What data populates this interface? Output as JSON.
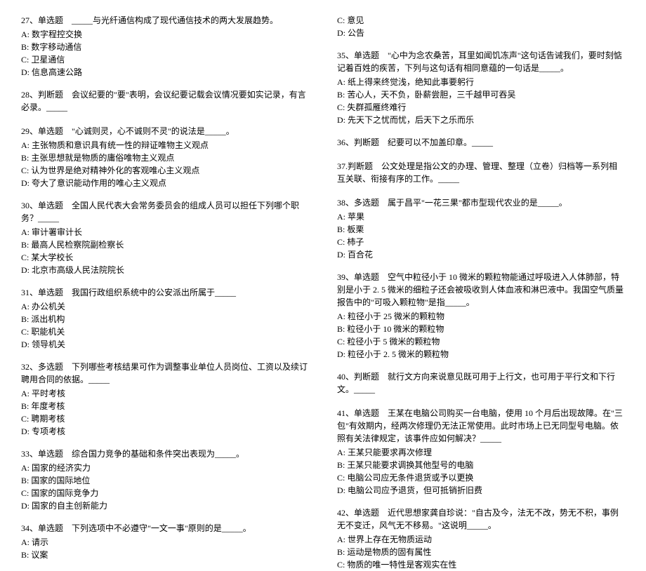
{
  "leftColumn": {
    "q27": {
      "text": "27、单选题　_____与光纤通信构成了现代通信技术的两大发展趋势。",
      "options": [
        "A: 数字程控交换",
        "B: 数字移动通信",
        "C: 卫星通信",
        "D: 信息高速公路"
      ]
    },
    "q28": {
      "text": "28、判断题　会议纪要的\"要\"表明，会议纪要记载会议情况要如实记录，有言必录。_____"
    },
    "q29": {
      "text": "29、单选题　\"心诚则灵，心不诚则不灵\"的说法是_____。",
      "options": [
        "A: 主张物质和意识具有统一性的辩证唯物主义观点",
        "B: 主张思想就是物质的庸俗唯物主义观点",
        "C: 认为世界是绝对精神外化的客观唯心主义观点",
        "D: 夸大了意识能动作用的唯心主义观点"
      ]
    },
    "q30": {
      "text": "30、单选题　全国人民代表大会常务委员会的组成人员可以担任下列哪个职务？_____",
      "options": [
        "A: 审计署审计长",
        "B: 最高人民检察院副检察长",
        "C: 某大学校长",
        "D: 北京市高级人民法院院长"
      ]
    },
    "q31": {
      "text": "31、单选题　我国行政组织系统中的公安派出所属于_____",
      "options": [
        "A: 办公机关",
        "B: 派出机构",
        "C: 职能机关",
        "D: 领导机关"
      ]
    },
    "q32": {
      "text": "32、多选题　下列哪些考核结果可作为调整事业单位人员岗位、工资以及续订聘用合同的依据。_____",
      "options": [
        "A: 平时考核",
        "B: 年度考核",
        "C: 聘期考核",
        "D: 专项考核"
      ]
    },
    "q33": {
      "text": "33、单选题　综合国力竞争的基础和条件突出表现为_____。",
      "options": [
        "A: 国家的经济实力",
        "B: 国家的国际地位",
        "C: 国家的国际竞争力",
        "D: 国家的自主创新能力"
      ]
    },
    "q34": {
      "text": "34、单选题　下列选项中不必遵守\"一文一事\"原则的是_____。",
      "options": [
        "A: 请示",
        "B: 议案"
      ]
    }
  },
  "rightColumn": {
    "q34cont": {
      "options": [
        "C: 意见",
        "D: 公告"
      ]
    },
    "q35": {
      "text": "35、单选题　\"心中为念农桑苦，耳里如闻饥冻声\"这句话告诫我们，要时刻惦记着百姓的疾苦，下列与这句话有相同意蕴的一句话是_____。",
      "options": [
        "A: 纸上得来终觉浅，绝知此事要躬行",
        "B: 苦心人，天不负，卧薪尝胆，三千越甲可吞吴",
        "C: 失群孤雁终难行",
        "D: 先天下之忧而忧，后天下之乐而乐"
      ]
    },
    "q36": {
      "text": "36、判断题　纪要可以不加盖印章。_____"
    },
    "q37": {
      "text": "37.判断题　公文处理是指公文的办理、管理、整理（立卷）归档等一系列相互关联、衔接有序的工作。_____"
    },
    "q38": {
      "text": "38、多选题　属于昌平\"一花三果\"都市型现代农业的是_____。",
      "options": [
        "A: 苹果",
        "B: 板栗",
        "C: 柿子",
        "D: 百合花"
      ]
    },
    "q39": {
      "text": "39、单选题　空气中粒径小于 10 微米的颗粒物能通过呼吸进入人体肺部，特别是小于 2. 5 微米的细粒子还会被吸收到人体血液和淋巴液中。我国空气质量报告中的\"可吸入颗粒物\"是指_____。",
      "options": [
        "A: 粒径小于 25 微米的颗粒物",
        "B: 粒径小于 10 微米的颗粒物",
        "C: 粒径小于 5 微米的颗粒物",
        "D: 粒径小于 2. 5 微米的颗粒物"
      ]
    },
    "q40": {
      "text": "40、判断题　就行文方向来说意见既可用于上行文，也可用于平行文和下行文。_____"
    },
    "q41": {
      "text": "41、单选题　王某在电脑公司购买一台电脑，使用 10 个月后出现故障。在\"三包\"有效期内，经两次修理仍无法正常使用。此时市场上已无同型号电脑。依照有关法律规定，该事件应如何解决？_____",
      "options": [
        "A: 王某只能要求再次修理",
        "B: 王某只能要求调换其他型号的电脑",
        "C: 电脑公司应无条件退货或予以更换",
        "D: 电脑公司应予退货，但可抵销折旧费"
      ]
    },
    "q42": {
      "text": "42、单选题　近代思想家龚自珍说：\"自古及今，法无不改，势无不积，事例无不变迁，风气无不移易。\"这说明_____。",
      "options": [
        "A: 世界上存在无物质运动",
        "B: 运动是物质的固有属性",
        "C: 物质的唯一特性是客观实在性"
      ]
    }
  }
}
